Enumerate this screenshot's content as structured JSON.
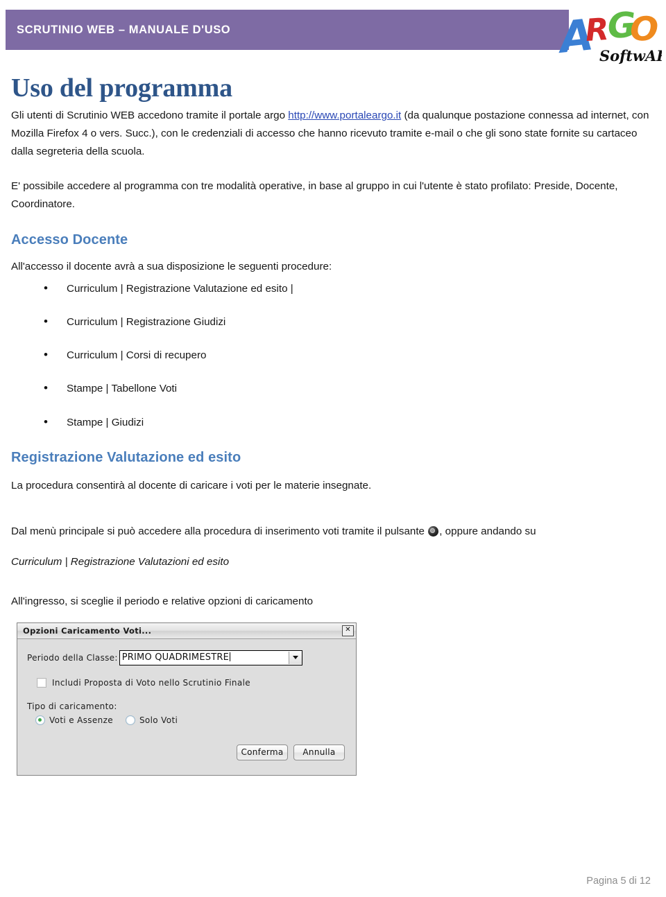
{
  "header": {
    "band_title": "SCRUTINIO WEB – MANUALE D'USO",
    "band_color": "#7e6ba4",
    "logo": {
      "letters": [
        {
          "char": "A",
          "color": "#3b7fd4"
        },
        {
          "char": "R",
          "color": "#d32a2a"
        },
        {
          "char": "G",
          "color": "#5fbb46"
        },
        {
          "char": "O",
          "color": "#ef8a1e"
        }
      ],
      "wordmark": "SoftwARE",
      "wordmark_color": "#111111"
    }
  },
  "doc": {
    "title": "Uso del programma",
    "title_color": "#2e5589",
    "intro": {
      "part1": "Gli utenti di Scrutinio WEB accedono tramite il portale argo ",
      "link_text": "http://www.portaleargo.it",
      "part2": " (da qualunque postazione connessa ad internet, con Mozilla Firefox 4 o vers. Succ.), con le credenziali di accesso che hanno ricevuto tramite e-mail o che gli sono state fornite su cartaceo dalla segreteria della scuola."
    },
    "modes_paragraph": "E' possibile accedere al programma con tre modalità operative, in base al gruppo in cui l'utente è stato profilato: Preside, Docente, Coordinatore."
  },
  "section_docente": {
    "heading": "Accesso Docente",
    "heading_color": "#4a7ebb",
    "intro": "All'accesso il docente avrà a sua disposizione le seguenti procedure:",
    "procedures": [
      "Curriculum | Registrazione Valutazione ed esito |",
      "Curriculum | Registrazione Giudizi",
      "Curriculum | Corsi di recupero",
      "Stampe | Tabellone Voti",
      "Stampe | Giudizi"
    ]
  },
  "section_registrazione": {
    "heading": "Registrazione Valutazione ed esito",
    "heading_color": "#4a7ebb",
    "paragraph1": "La procedura consentirà al docente di caricare i voti per le materie insegnate.",
    "access_line_before": "Dal menù principale si può accedere  alla procedura di inserimento voti tramite  il pulsante",
    "access_line_after": ", oppure andando su",
    "menu_path_italic": "Curriculum | Registrazione Valutazioni ed esito",
    "paragraph2": "All'ingresso, si sceglie il periodo e relative opzioni di caricamento"
  },
  "dialog": {
    "title": "Opzioni Caricamento Voti...",
    "close_label": "✕",
    "period_label": "Periodo della Classe:",
    "period_value": "PRIMO QUADRIMESTRE",
    "checkbox_label": "Includi Proposta di Voto nello Scrutinio Finale",
    "checkbox_checked": false,
    "group_label": "Tipo di caricamento:",
    "radios": [
      {
        "label": "Voti e Assenze",
        "checked": true
      },
      {
        "label": "Solo Voti",
        "checked": false
      }
    ],
    "confirm_label": "Conferma",
    "cancel_label": "Annulla"
  },
  "footer": {
    "page_indicator": "Pagina 5 di 12"
  }
}
